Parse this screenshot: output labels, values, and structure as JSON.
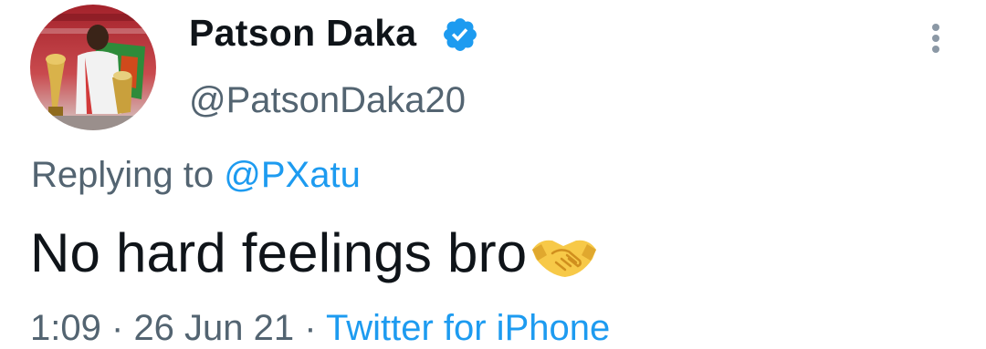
{
  "author": {
    "display_name": "Patson Daka",
    "handle": "@PatsonDaka20",
    "verified_icon": "verified-badge-icon"
  },
  "reply": {
    "prefix": "Replying to",
    "target": "@PXatu"
  },
  "tweet": {
    "text": "No hard feelings bro",
    "emoji_icon": "handshake-emoji-icon"
  },
  "meta": {
    "time": "1:09",
    "date": "26 Jun 21",
    "separator": "·",
    "source": "Twitter for iPhone"
  },
  "colors": {
    "accent": "#1d9bf0",
    "secondary_text": "#536471",
    "primary_text": "#0f1419"
  }
}
